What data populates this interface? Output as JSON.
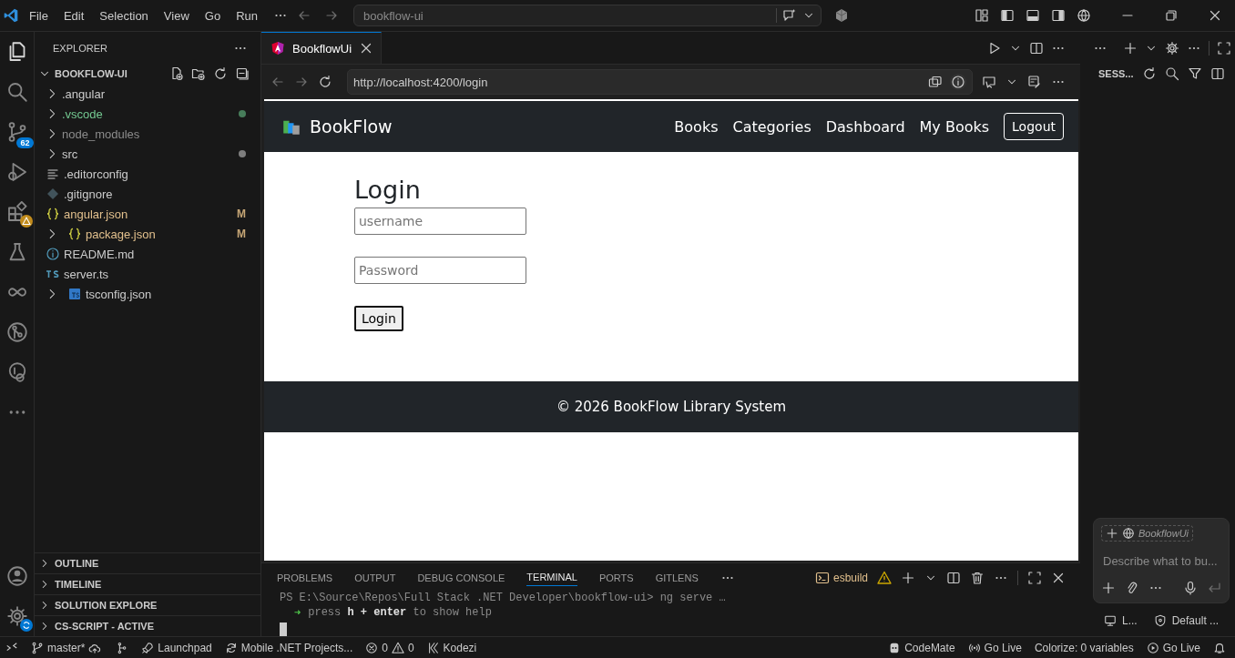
{
  "menu": [
    "File",
    "Edit",
    "Selection",
    "View",
    "Go",
    "Run"
  ],
  "command_center": {
    "text": "bookflow-ui"
  },
  "activity_bar": {
    "source_control_badge": "62"
  },
  "explorer": {
    "title": "EXPLORER",
    "root": {
      "label": "BOOKFLOW-UI",
      "expanded": true
    },
    "items": [
      {
        "label": ".angular",
        "kind": "folder",
        "expanded": false,
        "color": "#cccccc",
        "dot": false
      },
      {
        "label": ".vscode",
        "kind": "folder",
        "expanded": false,
        "color": "#73c991",
        "dot": true
      },
      {
        "label": "node_modules",
        "kind": "folder",
        "expanded": false,
        "color": "#8c8c8c",
        "dot": false
      },
      {
        "label": "src",
        "kind": "folder",
        "expanded": false,
        "color": "#cccccc",
        "dot": true
      },
      {
        "label": ".editorconfig",
        "kind": "config",
        "color": "#cccccc"
      },
      {
        "label": ".gitignore",
        "kind": "git",
        "color": "#cccccc"
      },
      {
        "label": "angular.json",
        "kind": "json",
        "color": "#e2c08d",
        "badge": "M"
      },
      {
        "label": "package.json",
        "kind": "json",
        "expanded": false,
        "color": "#e2c08d",
        "badge": "M"
      },
      {
        "label": "README.md",
        "kind": "info",
        "color": "#cccccc"
      },
      {
        "label": "server.ts",
        "kind": "ts",
        "color": "#cccccc"
      },
      {
        "label": "tsconfig.json",
        "kind": "tsconfig",
        "expanded": false,
        "color": "#cccccc"
      }
    ]
  },
  "sections": [
    {
      "label": "OUTLINE",
      "expanded": false
    },
    {
      "label": "TIMELINE",
      "expanded": false
    },
    {
      "label": "SOLUTION EXPLORE",
      "expanded": false
    },
    {
      "label": "CS-SCRIPT - ACTIVE",
      "expanded": false
    }
  ],
  "tab": {
    "label": "BookflowUi",
    "selected": true
  },
  "browser": {
    "url": "http://localhost:4200/login"
  },
  "site": {
    "brand": "BookFlow",
    "nav": [
      "Books",
      "Categories",
      "Dashboard",
      "My Books"
    ],
    "logout": "Logout",
    "heading": "Login",
    "fields": [
      {
        "placeholder": "username"
      },
      {
        "placeholder": "Password"
      }
    ],
    "submit": "Login",
    "footer": "© 2026 BookFlow Library System"
  },
  "panel": {
    "tabs": [
      {
        "label": "PROBLEMS",
        "selected": false
      },
      {
        "label": "OUTPUT",
        "selected": false
      },
      {
        "label": "DEBUG CONSOLE",
        "selected": false
      },
      {
        "label": "TERMINAL",
        "selected": true
      },
      {
        "label": "PORTS",
        "selected": false
      },
      {
        "label": "GITLENS",
        "selected": false
      }
    ],
    "terminal_name": "esbuild",
    "lines": [
      {
        "text": "PS E:\\Source\\Repos\\Full Stack .NET Developer\\bookflow-ui> ng serve …"
      },
      {
        "prompt": "➜",
        "text": "press **h + enter** to show help"
      }
    ]
  },
  "right_panel": {
    "title": "SESS...",
    "chat": {
      "context": "BookflowUi",
      "placeholder": "Describe what to bu..."
    },
    "footer": [
      {
        "kind": "monitor",
        "text": "L..."
      },
      {
        "kind": "shield",
        "text": "Default ..."
      }
    ]
  },
  "status_bar": {
    "left": [
      {
        "kind": "branch",
        "text": "master*"
      },
      {
        "kind": "launchpad",
        "text": "Launchpad"
      },
      {
        "kind": "sync",
        "text": "Mobile .NET Projects..."
      },
      {
        "kind": "problems",
        "errors": "0",
        "warnings": "0"
      },
      {
        "kind": "kodezi",
        "text": "Kodezi"
      }
    ],
    "right": [
      {
        "kind": "codemate",
        "text": "CodeMate"
      },
      {
        "kind": "broadcast",
        "text": "Go Live"
      },
      {
        "kind": "plain",
        "text": "Colorize: 0 variables"
      },
      {
        "kind": "play",
        "text": "Go Live"
      },
      {
        "kind": "bell"
      }
    ]
  }
}
